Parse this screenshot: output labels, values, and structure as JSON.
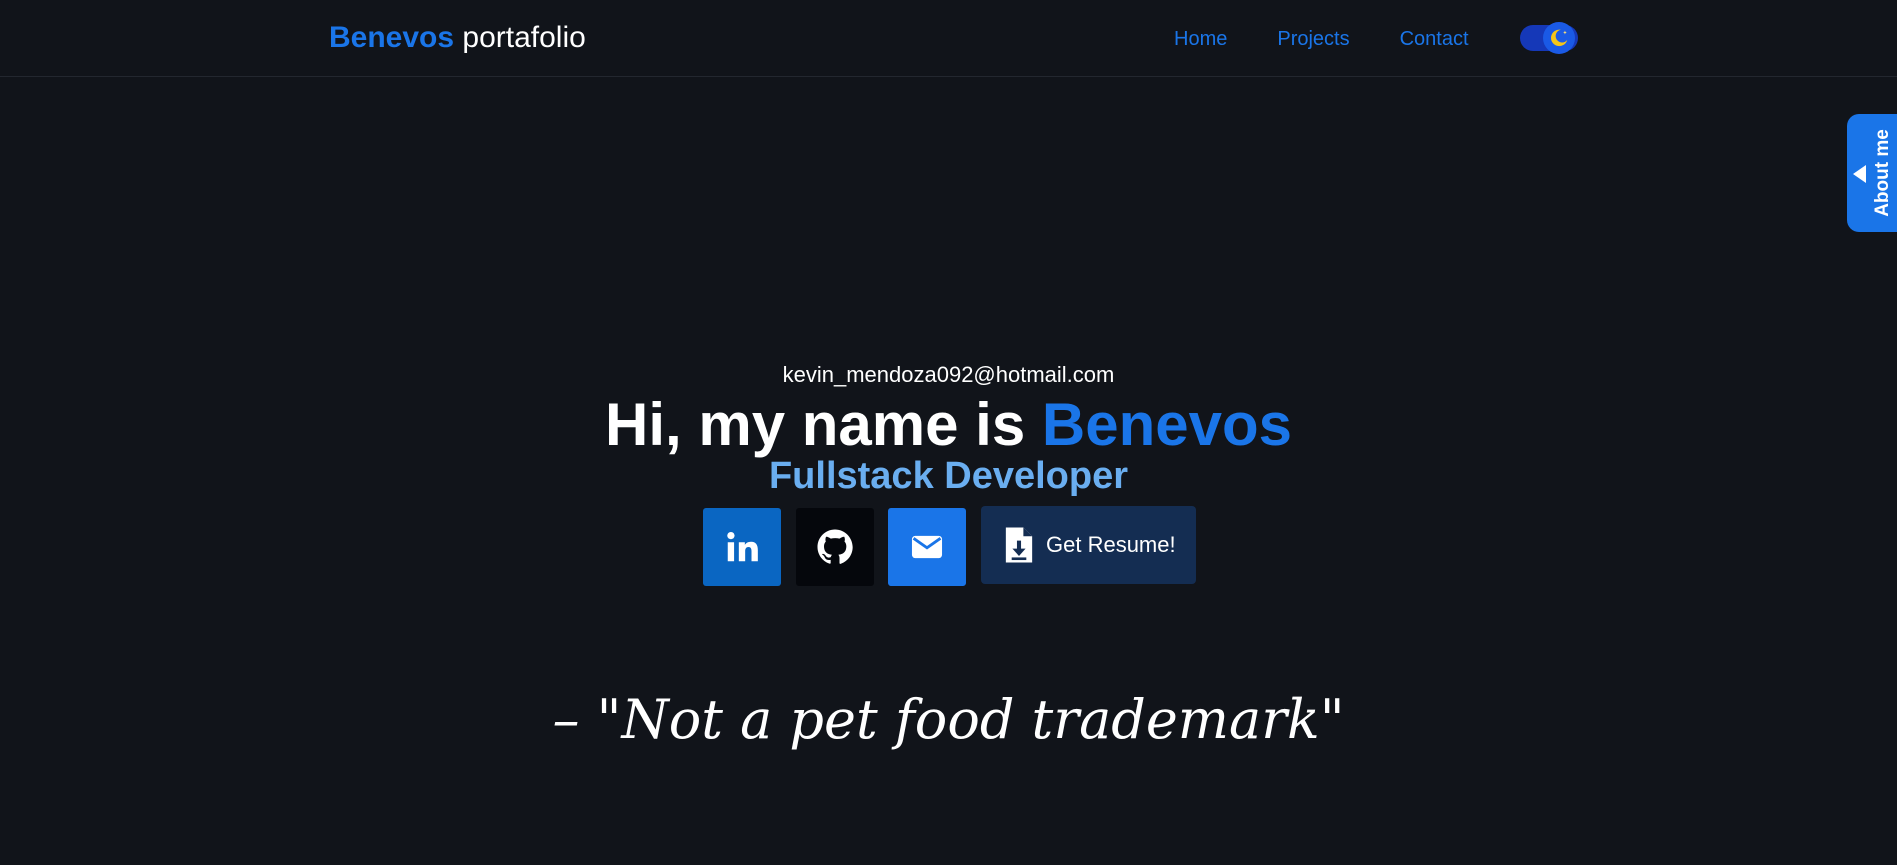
{
  "nav": {
    "brand_accent": "Benevos",
    "brand_rest": "portafolio",
    "links": [
      "Home",
      "Projects",
      "Contact"
    ],
    "theme_toggle": {
      "state": "dark",
      "icon": "moon-icon"
    }
  },
  "side_tab": {
    "label": "About me",
    "icon": "triangle-left-icon"
  },
  "hero": {
    "email": "kevin_mendoza092@hotmail.com",
    "title_prefix": "Hi, my name is ",
    "title_name": "Benevos",
    "subtitle": "Fullstack Developer",
    "buttons": [
      {
        "icon": "linkedin-icon",
        "color": "#0a66c2"
      },
      {
        "icon": "github-icon",
        "color": "#05070c"
      },
      {
        "icon": "mail-icon",
        "color": "#1a75e8"
      }
    ],
    "resume_label": "Get Resume!",
    "resume_icon": "file-download-icon"
  },
  "quote": "–  \"Not a pet food trademark\"",
  "colors": {
    "background": "#11141a",
    "accent": "#1a75e8",
    "subtitle": "#6aaef0",
    "resume_bg": "#142d52"
  }
}
